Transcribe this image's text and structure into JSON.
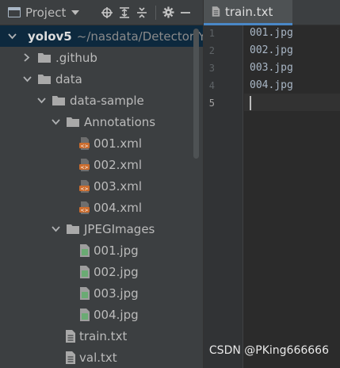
{
  "panel": {
    "title": "Project",
    "icons": [
      "project-window-icon",
      "dropdown-caret-icon",
      "locate-icon",
      "expand-all-icon",
      "collapse-all-icon",
      "gear-icon",
      "hide-icon"
    ]
  },
  "tree": {
    "root": {
      "label": "yolov5",
      "path": "~/nasdata/Detector/YO"
    },
    "github": ".github",
    "data": "data",
    "data_sample": "data-sample",
    "annotations": "Annotations",
    "xml_files": [
      "001.xml",
      "002.xml",
      "003.xml",
      "004.xml"
    ],
    "jpeg_images": "JPEGImages",
    "jpg_files": [
      "001.jpg",
      "002.jpg",
      "003.jpg",
      "004.jpg"
    ],
    "txt_files": [
      "train.txt",
      "val.txt"
    ]
  },
  "editor": {
    "tab_label": "train.txt",
    "line_numbers": [
      "1",
      "2",
      "3",
      "4",
      "5"
    ],
    "lines": [
      "001.jpg",
      "002.jpg",
      "003.jpg",
      "004.jpg",
      ""
    ]
  },
  "watermark": "CSDN @PKing666666",
  "colors": {
    "panel_bg": "#3c3f41",
    "editor_bg": "#2b2b2b",
    "selection": "#0d293e",
    "tab_accent": "#4a88c7",
    "folder": "#a9a9a9",
    "xml_badge": "#cc6d2e",
    "image_file": "#6aab73"
  }
}
